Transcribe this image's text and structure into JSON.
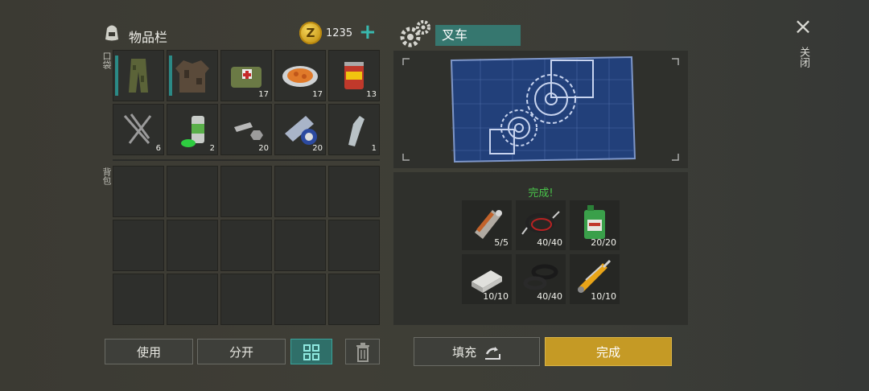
{
  "inventory": {
    "title": "物品栏",
    "coin_symbol": "Z",
    "coins": "1235",
    "add_coins": "+",
    "pocket_label": "口袋",
    "backpack_label": "背包",
    "pocket_items": [
      {
        "name": "camo-pants-icon",
        "count": ""
      },
      {
        "name": "camo-jacket-icon",
        "count": ""
      },
      {
        "name": "medkit-bag-icon",
        "count": "17"
      },
      {
        "name": "food-plate-icon",
        "count": "17"
      },
      {
        "name": "canned-food-icon",
        "count": "13"
      },
      {
        "name": "nails-icon",
        "count": "6"
      },
      {
        "name": "spray-can-icon",
        "count": "2"
      },
      {
        "name": "bolt-nut-icon",
        "count": "20"
      },
      {
        "name": "duct-tape-icon",
        "count": "20"
      },
      {
        "name": "plastic-bottle-icon",
        "count": "1"
      }
    ]
  },
  "buttons": {
    "use": "使用",
    "split": "分开",
    "fill": "填充",
    "complete": "完成"
  },
  "recipe": {
    "name": "叉车",
    "status": "完成!",
    "materials": [
      {
        "name": "electric-motor-icon",
        "count": "5/5"
      },
      {
        "name": "wires-icon",
        "count": "40/40"
      },
      {
        "name": "motor-oil-icon",
        "count": "20/20"
      },
      {
        "name": "metal-ingot-icon",
        "count": "10/10"
      },
      {
        "name": "rubber-seal-icon",
        "count": "40/40"
      },
      {
        "name": "hydraulic-cylinder-icon",
        "count": "10/10"
      }
    ]
  },
  "window": {
    "close": "×",
    "close_label": "关闭"
  },
  "colors": {
    "accent": "#36776f",
    "complete": "#c59a25",
    "status_green": "#49c24a"
  }
}
